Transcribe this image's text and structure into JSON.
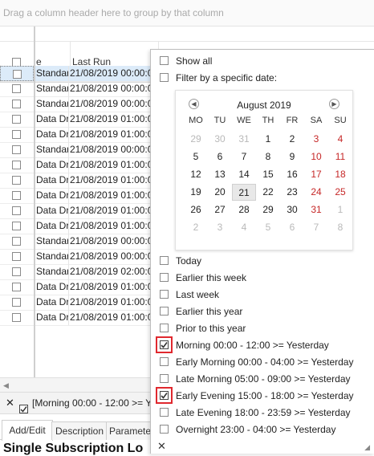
{
  "group_hint": "Drag a column header here to group by that column",
  "grid": {
    "columns": [
      "e",
      "Last Run"
    ],
    "rows": [
      {
        "type": "Standar",
        "last_run": "21/08/2019 00:00:0"
      },
      {
        "type": "Standar",
        "last_run": "21/08/2019 00:00:0"
      },
      {
        "type": "Standar",
        "last_run": "21/08/2019 00:00:0"
      },
      {
        "type": "Data Dri",
        "last_run": "21/08/2019 01:00:0"
      },
      {
        "type": "Data Dri",
        "last_run": "21/08/2019 01:00:0"
      },
      {
        "type": "Standar",
        "last_run": "21/08/2019 00:00:0"
      },
      {
        "type": "Data Dri",
        "last_run": "21/08/2019 01:00:0"
      },
      {
        "type": "Data Dri",
        "last_run": "21/08/2019 01:00:0"
      },
      {
        "type": "Data Dri",
        "last_run": "21/08/2019 01:00:0"
      },
      {
        "type": "Data Dri",
        "last_run": "21/08/2019 01:00:0"
      },
      {
        "type": "Data Dri",
        "last_run": "21/08/2019 01:00:0"
      },
      {
        "type": "Standar",
        "last_run": "21/08/2019 00:00:0"
      },
      {
        "type": "Standar",
        "last_run": "21/08/2019 00:00:0"
      },
      {
        "type": "Standar",
        "last_run": "21/08/2019 02:00:0"
      },
      {
        "type": "Data Dri",
        "last_run": "21/08/2019 01:00:0"
      },
      {
        "type": "Data Dri",
        "last_run": "21/08/2019 01:00:0"
      },
      {
        "type": "Data Dri",
        "last_run": "21/08/2019 01:00:0"
      }
    ]
  },
  "filter_bar": {
    "text": "[Morning 00:00 - 12:00 >= Ye"
  },
  "tabs": [
    "Add/Edit",
    "Description",
    "Paramete"
  ],
  "bottom_title": "Single Subscription Lo",
  "popup": {
    "show_all": "Show all",
    "filter_specific_date": "Filter by a specific date:",
    "calendar": {
      "month_label": "August 2019",
      "prev_icon": "chevron-left-icon",
      "next_icon": "chevron-right-icon",
      "days_of_week": [
        "MO",
        "TU",
        "WE",
        "TH",
        "FR",
        "SA",
        "SU"
      ],
      "weeks": [
        [
          "29",
          "30",
          "31",
          "1",
          "2",
          "3",
          "4"
        ],
        [
          "5",
          "6",
          "7",
          "8",
          "9",
          "10",
          "11"
        ],
        [
          "12",
          "13",
          "14",
          "15",
          "16",
          "17",
          "18"
        ],
        [
          "19",
          "20",
          "21",
          "22",
          "23",
          "24",
          "25"
        ],
        [
          "26",
          "27",
          "28",
          "29",
          "30",
          "31",
          "1"
        ],
        [
          "2",
          "3",
          "4",
          "5",
          "6",
          "7",
          "8"
        ]
      ],
      "today": "21",
      "weekend_color": "#c62828"
    },
    "options": [
      {
        "label": "Today",
        "checked": false
      },
      {
        "label": "Earlier this week",
        "checked": false
      },
      {
        "label": "Last week",
        "checked": false
      },
      {
        "label": "Earlier this year",
        "checked": false
      },
      {
        "label": "Prior to this year",
        "checked": false
      },
      {
        "label": "Morning 00:00 - 12:00 >= Yesterday",
        "checked": true
      },
      {
        "label": "Early Morning 00:00 - 04:00 >= Yesterday",
        "checked": false
      },
      {
        "label": "Late Morning 05:00 - 09:00 >= Yesterday",
        "checked": false
      },
      {
        "label": "Early Evening 15:00 - 18:00 >= Yesterday",
        "checked": true
      },
      {
        "label": "Late Evening 18:00 - 23:59 >= Yesterday",
        "checked": false
      },
      {
        "label": "Overnight 23:00 - 04:00 >= Yesterday",
        "checked": false
      }
    ],
    "highlight_color": "#e0282e"
  }
}
